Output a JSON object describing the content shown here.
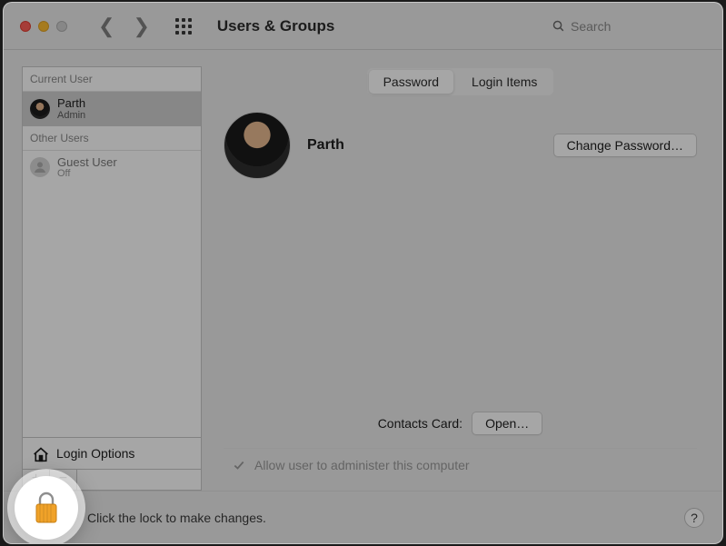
{
  "window": {
    "title": "Users & Groups"
  },
  "search": {
    "placeholder": "Search"
  },
  "sidebar": {
    "current_header": "Current User",
    "other_header": "Other Users",
    "current": {
      "name": "Parth",
      "role": "Admin"
    },
    "other": {
      "name": "Guest User",
      "status": "Off"
    },
    "login_options": "Login Options",
    "plus": "+",
    "minus": "−"
  },
  "tabs": {
    "password": "Password",
    "login_items": "Login Items"
  },
  "user": {
    "name": "Parth"
  },
  "buttons": {
    "change_password": "Change Password…",
    "open": "Open…"
  },
  "labels": {
    "contacts_card": "Contacts Card:",
    "allow_admin": "Allow user to administer this computer"
  },
  "footer": {
    "lock_text": "Click the lock to make changes.",
    "help": "?"
  },
  "icons": {
    "search": "search-icon",
    "back": "chevron-left-icon",
    "forward": "chevron-right-icon",
    "apps_grid": "apps-grid-icon",
    "home": "home-icon",
    "lock": "lock-icon",
    "check": "check-icon"
  },
  "colors": {
    "lock_fill": "#f0a229",
    "lock_stroke": "#8e8e8e"
  }
}
